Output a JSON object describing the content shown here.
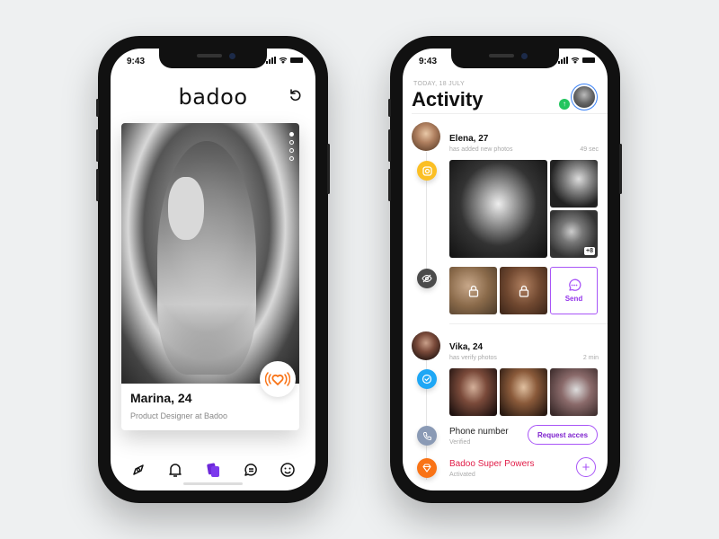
{
  "status": {
    "time": "9:43"
  },
  "discover": {
    "logo": "badoo",
    "undo_icon": "undo-icon",
    "card": {
      "name": "Marina, 24",
      "subtitle": "Product Designer at Badoo",
      "photo_count": 4,
      "active_photo": 1
    },
    "like_icon": "heart-waves-icon",
    "tabs": [
      {
        "icon": "compass-icon",
        "active": false
      },
      {
        "icon": "bell-icon",
        "active": false
      },
      {
        "icon": "cards-icon",
        "active": true
      },
      {
        "icon": "chat-icon",
        "active": false
      },
      {
        "icon": "smiley-icon",
        "active": false
      }
    ]
  },
  "activity": {
    "date": "TODAY, 18 JULY",
    "title": "Activity",
    "upload_badge": "↑",
    "feed": [
      {
        "name": "Elena, 27",
        "action": "has added new photos",
        "time": "49 sec",
        "icon": "instagram-icon",
        "more_photos": "+8"
      },
      {
        "icon": "hidden-icon",
        "locked_photos": 2,
        "send_label": "Send"
      },
      {
        "name": "Vika, 24",
        "action": "has verify photos",
        "time": "2 min",
        "icon": "verified-check-icon"
      },
      {
        "title": "Phone number",
        "status": "Verified",
        "icon": "phone-icon",
        "action_label": "Request acces"
      },
      {
        "title": "Badoo Super Powers",
        "status": "Activated",
        "icon": "diamond-icon",
        "action_icon": "plus-icon"
      }
    ]
  },
  "colors": {
    "accent_purple": "#7c3aed",
    "outline_purple": "#a855f7",
    "like_orange": "#f97316",
    "instagram_yellow": "#fbbf24",
    "verify_blue": "#1ea7f5",
    "phone_gray": "#8a9ab5",
    "super_orange": "#f97316",
    "super_red": "#e11d48",
    "online_green": "#22c55e"
  }
}
